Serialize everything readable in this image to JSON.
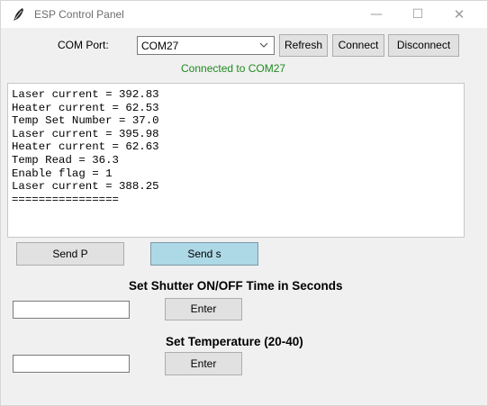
{
  "window": {
    "title": "ESP Control Panel",
    "controls": {
      "minimize": "—",
      "maximize": "☐",
      "close": "✕"
    }
  },
  "com": {
    "label": "COM Port:",
    "selected": "COM27",
    "refresh": "Refresh",
    "connect": "Connect",
    "disconnect": "Disconnect",
    "status": "Connected to COM27"
  },
  "log": [
    "Laser current = 392.83",
    "Heater current = 62.53",
    "Temp Set Number = 37.0",
    "Laser current = 395.98",
    "Heater current = 62.63",
    "Temp Read = 36.3",
    "Enable flag = 1",
    "Laser current = 388.25",
    "================"
  ],
  "send": {
    "p_label": "Send P",
    "s_label": "Send s"
  },
  "shutter": {
    "heading": "Set Shutter ON/OFF Time in Seconds",
    "value": "",
    "enter": "Enter"
  },
  "temperature": {
    "heading": "Set Temperature (20-40)",
    "value": "",
    "enter": "Enter"
  },
  "colors": {
    "status_green": "#1f8a1f",
    "active_button": "#add8e6"
  }
}
